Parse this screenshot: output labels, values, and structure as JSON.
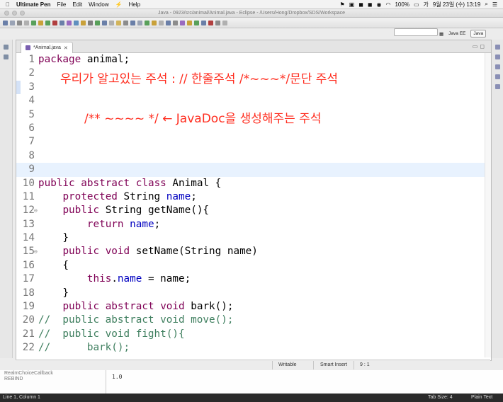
{
  "menubar": {
    "app_name": "Ultimate Pen",
    "items": [
      "File",
      "Edit",
      "Window",
      "Help"
    ],
    "battery": "100%",
    "datetime": "9월 23일 (수)  13:19"
  },
  "window": {
    "title": "Java - 0923/src/animal/Animal.java - Eclipse - /Users/Hong/Dropbox/SDS/Workspace"
  },
  "perspectives": [
    "Java EE",
    "Java"
  ],
  "editor": {
    "tab_label": "*Animal.java",
    "lines": [
      {
        "n": "1",
        "tokens": [
          {
            "t": "package",
            "c": "kw"
          },
          {
            "t": " animal;",
            "c": "txt"
          }
        ]
      },
      {
        "n": "2",
        "tokens": []
      },
      {
        "n": "3",
        "tokens": [],
        "marker": true
      },
      {
        "n": "4",
        "tokens": []
      },
      {
        "n": "5",
        "tokens": []
      },
      {
        "n": "6",
        "tokens": []
      },
      {
        "n": "7",
        "tokens": []
      },
      {
        "n": "8",
        "tokens": []
      },
      {
        "n": "9",
        "tokens": [],
        "current": true
      },
      {
        "n": "10",
        "tokens": [
          {
            "t": "public",
            "c": "kw"
          },
          {
            "t": " ",
            "c": "txt"
          },
          {
            "t": "abstract",
            "c": "kw"
          },
          {
            "t": " ",
            "c": "txt"
          },
          {
            "t": "class",
            "c": "kw"
          },
          {
            "t": " Animal {",
            "c": "txt"
          }
        ]
      },
      {
        "n": "11",
        "tokens": [
          {
            "t": "    ",
            "c": "txt"
          },
          {
            "t": "protected",
            "c": "kw"
          },
          {
            "t": " String ",
            "c": "txt"
          },
          {
            "t": "name",
            "c": "fld"
          },
          {
            "t": ";",
            "c": "txt"
          }
        ]
      },
      {
        "n": "12",
        "fold": true,
        "tokens": [
          {
            "t": "    ",
            "c": "txt"
          },
          {
            "t": "public",
            "c": "kw"
          },
          {
            "t": " String getName(){",
            "c": "txt"
          }
        ]
      },
      {
        "n": "13",
        "tokens": [
          {
            "t": "        ",
            "c": "txt"
          },
          {
            "t": "return",
            "c": "kw"
          },
          {
            "t": " ",
            "c": "txt"
          },
          {
            "t": "name",
            "c": "fld"
          },
          {
            "t": ";",
            "c": "txt"
          }
        ]
      },
      {
        "n": "14",
        "tokens": [
          {
            "t": "    }",
            "c": "txt"
          }
        ]
      },
      {
        "n": "15",
        "fold": true,
        "tokens": [
          {
            "t": "    ",
            "c": "txt"
          },
          {
            "t": "public",
            "c": "kw"
          },
          {
            "t": " ",
            "c": "txt"
          },
          {
            "t": "void",
            "c": "kw"
          },
          {
            "t": " setName(String name)",
            "c": "txt"
          }
        ]
      },
      {
        "n": "16",
        "tokens": [
          {
            "t": "    {",
            "c": "txt"
          }
        ]
      },
      {
        "n": "17",
        "tokens": [
          {
            "t": "        ",
            "c": "txt"
          },
          {
            "t": "this",
            "c": "kw"
          },
          {
            "t": ".",
            "c": "txt"
          },
          {
            "t": "name",
            "c": "fld"
          },
          {
            "t": " = name;",
            "c": "txt"
          }
        ]
      },
      {
        "n": "18",
        "tokens": [
          {
            "t": "    }",
            "c": "txt"
          }
        ]
      },
      {
        "n": "19",
        "tokens": [
          {
            "t": "    ",
            "c": "txt"
          },
          {
            "t": "public",
            "c": "kw"
          },
          {
            "t": " ",
            "c": "txt"
          },
          {
            "t": "abstract",
            "c": "kw"
          },
          {
            "t": " ",
            "c": "txt"
          },
          {
            "t": "void",
            "c": "kw"
          },
          {
            "t": " bark();",
            "c": "txt"
          }
        ]
      },
      {
        "n": "20",
        "tokens": [
          {
            "t": "//  public abstract void move();",
            "c": "cm"
          }
        ]
      },
      {
        "n": "21",
        "tokens": [
          {
            "t": "//  public void fight(){",
            "c": "cm"
          }
        ]
      },
      {
        "n": "22",
        "tokens": [
          {
            "t": "//      bark();",
            "c": "cm"
          }
        ]
      }
    ],
    "annotations": [
      "우리가 알고있는 주석 : // 한줄주석  /*~~~*/문단 주석",
      "/** ~~~~ */      ← JavaDoc을 생성해주는 주석"
    ]
  },
  "statusbar": {
    "writable": "Writable",
    "insert_mode": "Smart Insert",
    "position": "9 : 1"
  },
  "background_window": {
    "left_text": [
      "RealmChoiceCallback",
      "REBIND"
    ],
    "right_text": "1.0"
  },
  "bottom_bar": {
    "left": "Line 1, Column 1",
    "tab_size": "Tab Size: 4",
    "syntax": "Plain Text"
  }
}
